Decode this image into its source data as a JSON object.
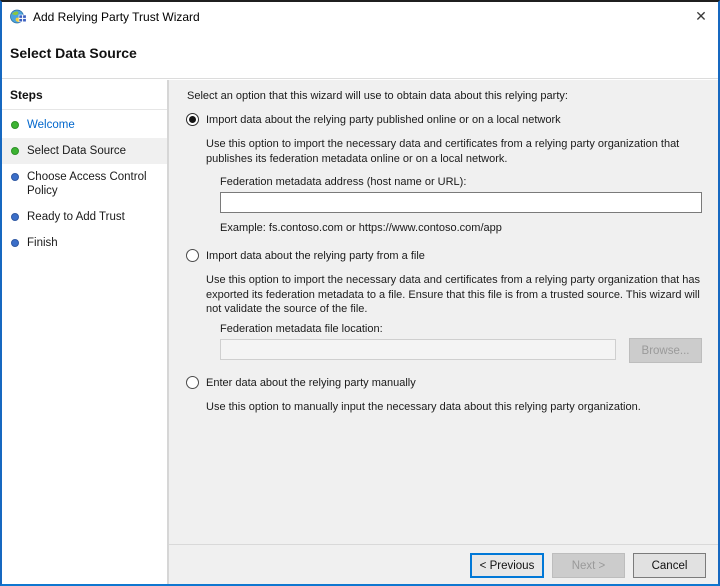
{
  "window": {
    "title": "Add Relying Party Trust Wizard",
    "close_glyph": "✕"
  },
  "header": {
    "title": "Select Data Source"
  },
  "sidebar": {
    "title": "Steps",
    "items": [
      {
        "label": "Welcome",
        "state": "done"
      },
      {
        "label": "Select Data Source",
        "state": "current"
      },
      {
        "label": "Choose Access Control Policy",
        "state": "upcoming"
      },
      {
        "label": "Ready to Add Trust",
        "state": "upcoming"
      },
      {
        "label": "Finish",
        "state": "upcoming"
      }
    ]
  },
  "content": {
    "instruction": "Select an option that this wizard will use to obtain data about this relying party:",
    "options": [
      {
        "label": "Import data about the relying party published online or on a local network",
        "selected": true,
        "description": "Use this option to import the necessary data and certificates from a relying party organization that publishes its federation metadata online or on a local network.",
        "field_label": "Federation metadata address (host name or URL):",
        "field_value": "",
        "example": "Example: fs.contoso.com or https://www.contoso.com/app"
      },
      {
        "label": "Import data about the relying party from a file",
        "selected": false,
        "description": "Use this option to import the necessary data and certificates from a relying party organization that has exported its federation metadata to a file. Ensure that this file is from a trusted source.  This wizard will not validate the source of the file.",
        "field_label": "Federation metadata file location:",
        "field_value": "",
        "browse_label": "Browse..."
      },
      {
        "label": "Enter data about the relying party manually",
        "selected": false,
        "description": "Use this option to manually input the necessary data about this relying party organization."
      }
    ]
  },
  "footer": {
    "previous_label": "< Previous",
    "next_label": "Next >",
    "cancel_label": "Cancel"
  },
  "colors": {
    "accent_border": "#1668c0",
    "focus_blue": "#0078d7",
    "link_blue": "#0066cc",
    "done_bullet_green": "#3cb332",
    "upcoming_bullet_blue": "#3b6fc9",
    "content_bg": "#f0f0f0",
    "selected_step_bg": "#f0f0f0"
  }
}
